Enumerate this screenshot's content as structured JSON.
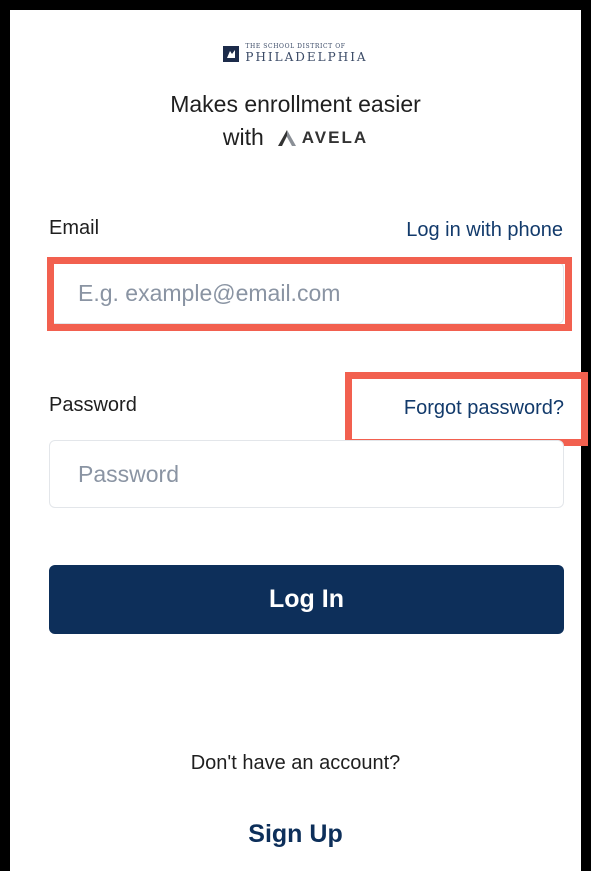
{
  "branding": {
    "district_small": "THE SCHOOL DISTRICT OF",
    "district_name": "PHILADELPHIA",
    "tagline_line1": "Makes enrollment easier",
    "tagline_with": "with",
    "partner_name": "AVELA",
    "logo_icon": "school-district-logo-icon",
    "partner_icon": "avela-logo-icon"
  },
  "email": {
    "label": "Email",
    "alt_login_link": "Log in with phone",
    "placeholder": "E.g. example@email.com",
    "value": ""
  },
  "password": {
    "label": "Password",
    "forgot_link": "Forgot password?",
    "placeholder": "Password",
    "value": ""
  },
  "actions": {
    "login_label": "Log In",
    "no_account_text": "Don't have an account?",
    "signup_label": "Sign Up"
  },
  "colors": {
    "primary": "#0d2f5a",
    "link": "#123a6b",
    "highlight": "#f2604f"
  }
}
